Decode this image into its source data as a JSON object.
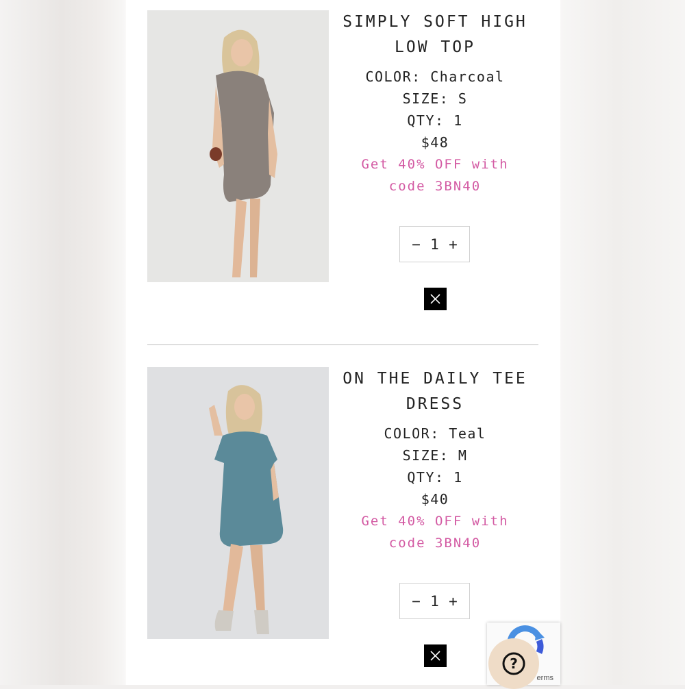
{
  "cart": {
    "items": [
      {
        "title": "SIMPLY SOFT HIGH LOW TOP",
        "color": "COLOR: Charcoal",
        "size": "SIZE: S",
        "qty_label": "QTY: 1",
        "price": "$48",
        "promo": "Get 40% OFF with code 3BN40",
        "stepper": {
          "minus": "−",
          "value": "1",
          "plus": "+"
        },
        "garment_color": "#8a817b"
      },
      {
        "title": "ON THE DAILY TEE DRESS",
        "color": "COLOR: Teal",
        "size": "SIZE: M",
        "qty_label": "QTY: 1",
        "price": "$40",
        "promo": "Get 40% OFF with code 3BN40",
        "stepper": {
          "minus": "−",
          "value": "1",
          "plus": "+"
        },
        "garment_color": "#5b8a99"
      }
    ]
  },
  "recaptcha": {
    "text": "erms"
  },
  "help": {
    "icon": "question-mark-icon",
    "label": "?"
  },
  "colors": {
    "promo": "#d35aa3",
    "remove_bg": "#000000",
    "help_bg": "#efdcc7"
  }
}
